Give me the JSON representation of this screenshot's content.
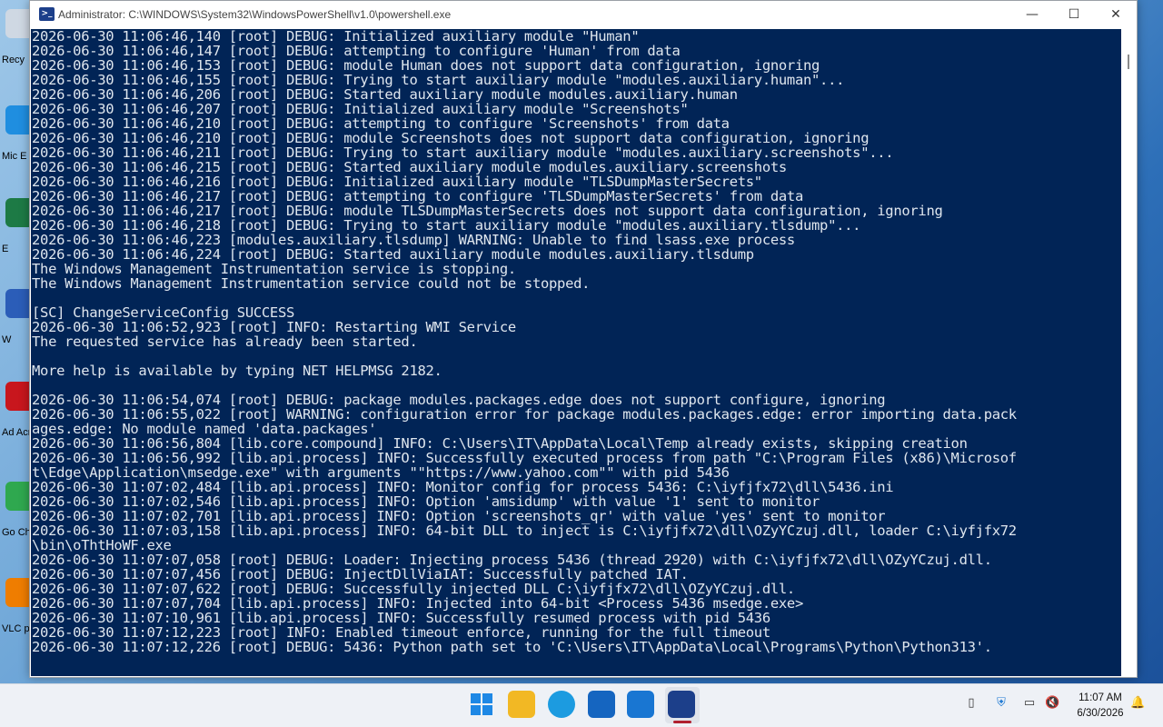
{
  "window": {
    "title": "Administrator: C:\\WINDOWS\\System32\\WindowsPowerShell\\v1.0\\powershell.exe",
    "controls": {
      "minimize": "—",
      "maximize": "☐",
      "close": "✕"
    }
  },
  "console": {
    "lines": [
      "2026-06-30 11:06:46,140 [root] DEBUG: Initialized auxiliary module \"Human\"",
      "2026-06-30 11:06:46,147 [root] DEBUG: attempting to configure 'Human' from data",
      "2026-06-30 11:06:46,153 [root] DEBUG: module Human does not support data configuration, ignoring",
      "2026-06-30 11:06:46,155 [root] DEBUG: Trying to start auxiliary module \"modules.auxiliary.human\"...",
      "2026-06-30 11:06:46,206 [root] DEBUG: Started auxiliary module modules.auxiliary.human",
      "2026-06-30 11:06:46,207 [root] DEBUG: Initialized auxiliary module \"Screenshots\"",
      "2026-06-30 11:06:46,210 [root] DEBUG: attempting to configure 'Screenshots' from data",
      "2026-06-30 11:06:46,210 [root] DEBUG: module Screenshots does not support data configuration, ignoring",
      "2026-06-30 11:06:46,211 [root] DEBUG: Trying to start auxiliary module \"modules.auxiliary.screenshots\"...",
      "2026-06-30 11:06:46,215 [root] DEBUG: Started auxiliary module modules.auxiliary.screenshots",
      "2026-06-30 11:06:46,216 [root] DEBUG: Initialized auxiliary module \"TLSDumpMasterSecrets\"",
      "2026-06-30 11:06:46,217 [root] DEBUG: attempting to configure 'TLSDumpMasterSecrets' from data",
      "2026-06-30 11:06:46,217 [root] DEBUG: module TLSDumpMasterSecrets does not support data configuration, ignoring",
      "2026-06-30 11:06:46,218 [root] DEBUG: Trying to start auxiliary module \"modules.auxiliary.tlsdump\"...",
      "2026-06-30 11:06:46,223 [modules.auxiliary.tlsdump] WARNING: Unable to find lsass.exe process",
      "2026-06-30 11:06:46,224 [root] DEBUG: Started auxiliary module modules.auxiliary.tlsdump",
      "The Windows Management Instrumentation service is stopping.",
      "The Windows Management Instrumentation service could not be stopped.",
      "",
      "[SC] ChangeServiceConfig SUCCESS",
      "2026-06-30 11:06:52,923 [root] INFO: Restarting WMI Service",
      "The requested service has already been started.",
      "",
      "More help is available by typing NET HELPMSG 2182.",
      "",
      "2026-06-30 11:06:54,074 [root] DEBUG: package modules.packages.edge does not support configure, ignoring",
      "2026-06-30 11:06:55,022 [root] WARNING: configuration error for package modules.packages.edge: error importing data.pack",
      "ages.edge: No module named 'data.packages'",
      "2026-06-30 11:06:56,804 [lib.core.compound] INFO: C:\\Users\\IT\\AppData\\Local\\Temp already exists, skipping creation",
      "2026-06-30 11:06:56,992 [lib.api.process] INFO: Successfully executed process from path \"C:\\Program Files (x86)\\Microsof",
      "t\\Edge\\Application\\msedge.exe\" with arguments \"\"https://www.yahoo.com\"\" with pid 5436",
      "2026-06-30 11:07:02,484 [lib.api.process] INFO: Monitor config for process 5436: C:\\iyfjfx72\\dll\\5436.ini",
      "2026-06-30 11:07:02,546 [lib.api.process] INFO: Option 'amsidump' with value '1' sent to monitor",
      "2026-06-30 11:07:02,701 [lib.api.process] INFO: Option 'screenshots_qr' with value 'yes' sent to monitor",
      "2026-06-30 11:07:03,158 [lib.api.process] INFO: 64-bit DLL to inject is C:\\iyfjfx72\\dll\\OZyYCzuj.dll, loader C:\\iyfjfx72",
      "\\bin\\oThtHoWF.exe",
      "2026-06-30 11:07:07,058 [root] DEBUG: Loader: Injecting process 5436 (thread 2920) with C:\\iyfjfx72\\dll\\OZyYCzuj.dll.",
      "2026-06-30 11:07:07,456 [root] DEBUG: InjectDllViaIAT: Successfully patched IAT.",
      "2026-06-30 11:07:07,622 [root] DEBUG: Successfully injected DLL C:\\iyfjfx72\\dll\\OZyYCzuj.dll.",
      "2026-06-30 11:07:07,704 [lib.api.process] INFO: Injected into 64-bit <Process 5436 msedge.exe>",
      "2026-06-30 11:07:10,961 [lib.api.process] INFO: Successfully resumed process with pid 5436",
      "2026-06-30 11:07:12,223 [root] INFO: Enabled timeout enforce, running for the full timeout",
      "2026-06-30 11:07:12,226 [root] DEBUG: 5436: Python path set to 'C:\\Users\\IT\\AppData\\Local\\Programs\\Python\\Python313'."
    ]
  },
  "desktop": {
    "icons": [
      {
        "name": "recycle-bin",
        "label": "Recy",
        "color": "#cfd8e3"
      },
      {
        "name": "edge",
        "label": "Mic E",
        "color": "#1f8ee0"
      },
      {
        "name": "excel",
        "label": "E",
        "color": "#1d7a45"
      },
      {
        "name": "word",
        "label": "W",
        "color": "#2b5db8"
      },
      {
        "name": "acrobat",
        "label": "Ad Acr",
        "color": "#c8161d"
      },
      {
        "name": "chrome",
        "label": "Go Chr",
        "color": "#2fa84f"
      },
      {
        "name": "vlc",
        "label": "VLC pl",
        "color": "#ef7d00"
      }
    ]
  },
  "taskbar": {
    "apps": [
      {
        "name": "start",
        "color": "#1e88e5"
      },
      {
        "name": "file-explorer",
        "color": "#f2b824"
      },
      {
        "name": "edge",
        "color": "#1c9be0"
      },
      {
        "name": "microsoft-store",
        "color": "#1565c0"
      },
      {
        "name": "outlook",
        "color": "#1976d2"
      },
      {
        "name": "powershell",
        "color": "#1c3f8a"
      }
    ],
    "clock": {
      "time": "11:07 AM",
      "date": "6/30/2026"
    }
  }
}
